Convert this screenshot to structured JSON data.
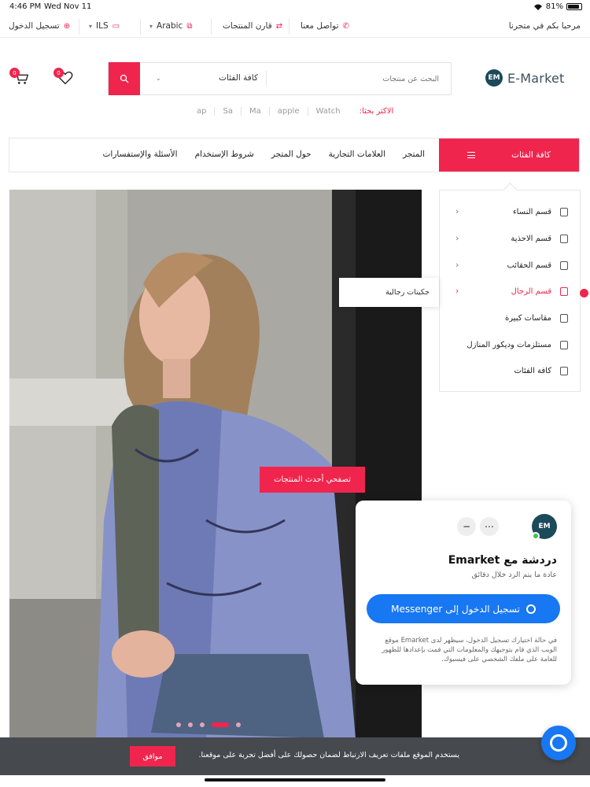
{
  "status_bar": {
    "time": "4:46 PM",
    "date": "Wed Nov 11",
    "battery": "81%"
  },
  "topbar": {
    "welcome": "مرحبا بكم في متجرنا",
    "contact": "تواصل معنا",
    "compare": "قارن المنتجات",
    "language": "Arabic",
    "currency": "ILS",
    "login": "تسجيل الدخول"
  },
  "header": {
    "logo_text": "E-Market",
    "logo_mark": "EM",
    "search_placeholder": "البحث عن منتجات",
    "category_select": "كافة الفئات",
    "cart_count": "0",
    "wishlist_count": "0"
  },
  "popular": {
    "label": "الاكثر بحثا:",
    "tags": [
      "Watch",
      "apple",
      "Ma",
      "Sa",
      "ap"
    ]
  },
  "nav": {
    "all_categories": "كافة الفئات",
    "links": [
      "المتجر",
      "العلامات التجارية",
      "حول المتجر",
      "شروط الإستخدام",
      "الأسئلة والإستفسارات"
    ]
  },
  "categories": [
    {
      "label": "قسم النساء",
      "icon": "dress-icon",
      "has_arrow": true,
      "active": false
    },
    {
      "label": "قسم الاحذية",
      "icon": "shoe-icon",
      "has_arrow": true,
      "active": false
    },
    {
      "label": "قسم الحقائب",
      "icon": "bag-icon",
      "has_arrow": true,
      "active": false
    },
    {
      "label": "قسم الرجال",
      "icon": "shirt-icon",
      "has_arrow": true,
      "active": true
    },
    {
      "label": "مقاسات كبيرة",
      "icon": "shirt-icon",
      "has_arrow": false,
      "active": false
    },
    {
      "label": "مستلزمات وديكور المنازل",
      "icon": "home-icon",
      "has_arrow": false,
      "active": false
    },
    {
      "label": "كافة الفئات",
      "icon": "grid-icon",
      "has_arrow": false,
      "active": false
    }
  ],
  "subcategory_popup": "جكيتات رجالية",
  "hero": {
    "cta": "تصفحي أحدث المنتجات",
    "slides": 5,
    "active_slide": 2
  },
  "messenger": {
    "title": "دردشة مع Emarket",
    "subtitle": "عادة ما يتم الرد خلال دقائق",
    "button": "تسجيل الدخول إلى Messenger",
    "note": "في حالة اختيارك تسجيل الدخول، سيظهر لدى Emarket موقع الويب الذي قام بتوجيهك والمعلومات التي قمت بإعدادها للظهور للعامة على ملفك الشخصي على فيسبوك."
  },
  "cookie": {
    "text": "يستخدم الموقع ملفات تعريف الارتباط لضمان حصولك على أفضل تجربة على موقعنا.",
    "accept": "موافق"
  },
  "colors": {
    "accent": "#f0254e",
    "messenger": "#1877f2",
    "cookie_bg": "#46494d",
    "logo_bg": "#1b4a5a"
  }
}
